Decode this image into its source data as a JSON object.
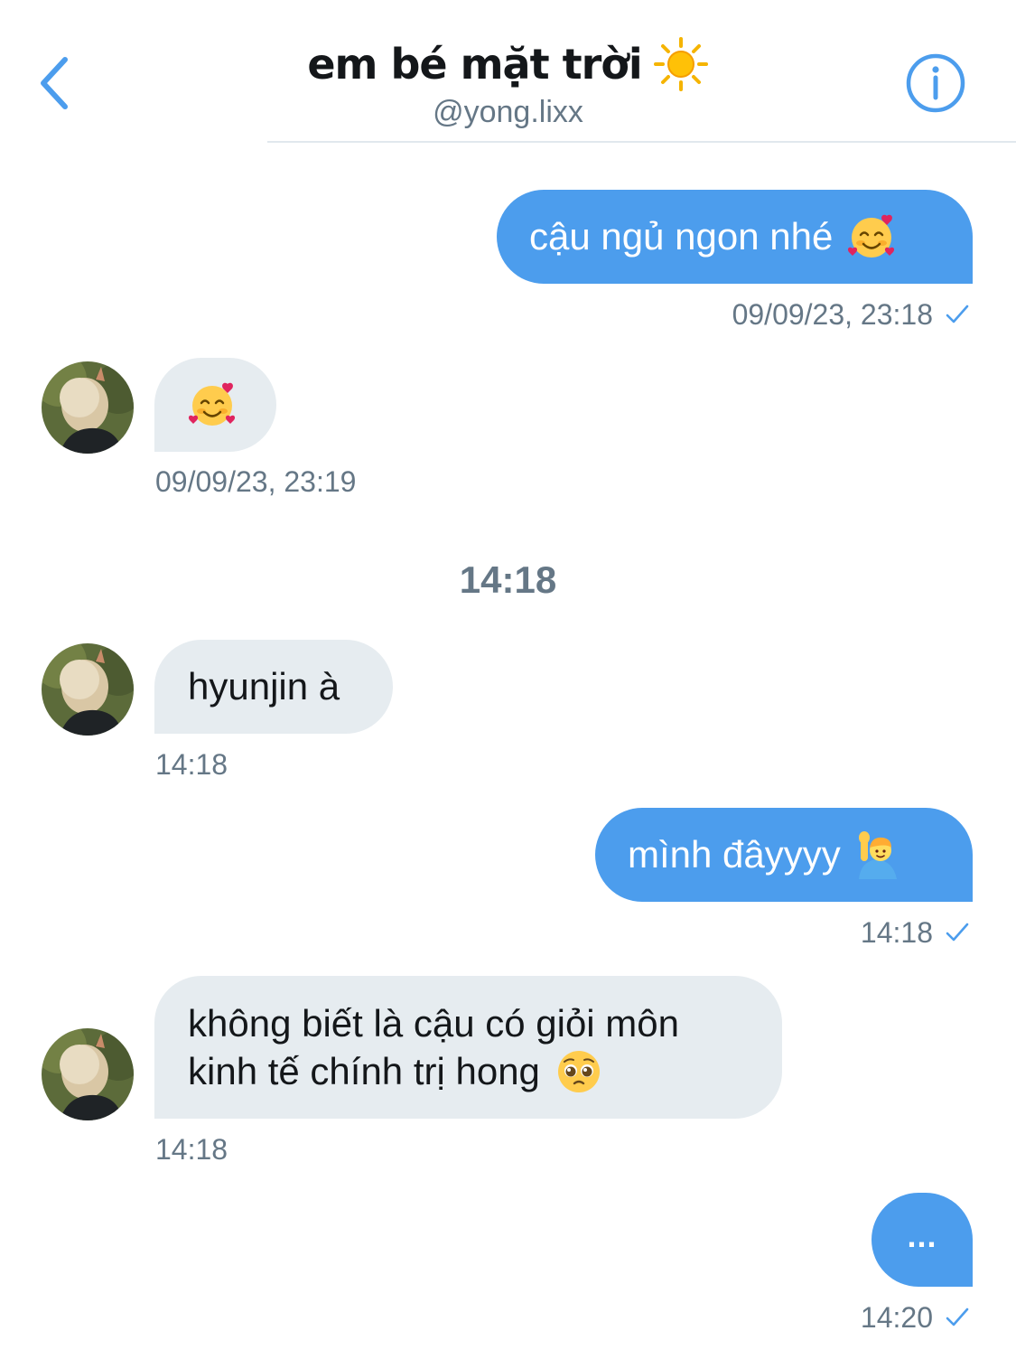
{
  "header": {
    "title": "em bé mặt trời",
    "title_emoji": "sun-icon",
    "handle": "@yong.lixx",
    "back_icon": "chevron-left-icon",
    "info_icon": "info-icon"
  },
  "colors": {
    "accent": "#4c9ded",
    "received_bubble": "#e6ecf0",
    "secondary_text": "#657786"
  },
  "messages": [
    {
      "side": "sent",
      "text": "cậu ngủ ngon nhé",
      "emoji": "smiling-face-with-hearts-icon",
      "time": "09/09/23, 23:18",
      "status": "sent-check-icon"
    },
    {
      "side": "received",
      "text": "",
      "emoji": "smiling-face-with-hearts-icon",
      "time": "09/09/23, 23:19"
    },
    {
      "side": "received",
      "text": "hyunjin à",
      "time": "14:18"
    },
    {
      "side": "sent",
      "text": "mình đâyyyy",
      "emoji": "man-raising-hand-icon",
      "time": "14:18",
      "status": "sent-check-icon"
    },
    {
      "side": "received",
      "text_line1": "không biết là cậu có giỏi môn",
      "text_line2": "kinh tế chính trị hong",
      "emoji": "pleading-face-icon",
      "time": "14:18"
    },
    {
      "side": "sent",
      "text": "...",
      "time": "14:20",
      "status": "sent-check-icon"
    }
  ],
  "separator_time": "14:18"
}
